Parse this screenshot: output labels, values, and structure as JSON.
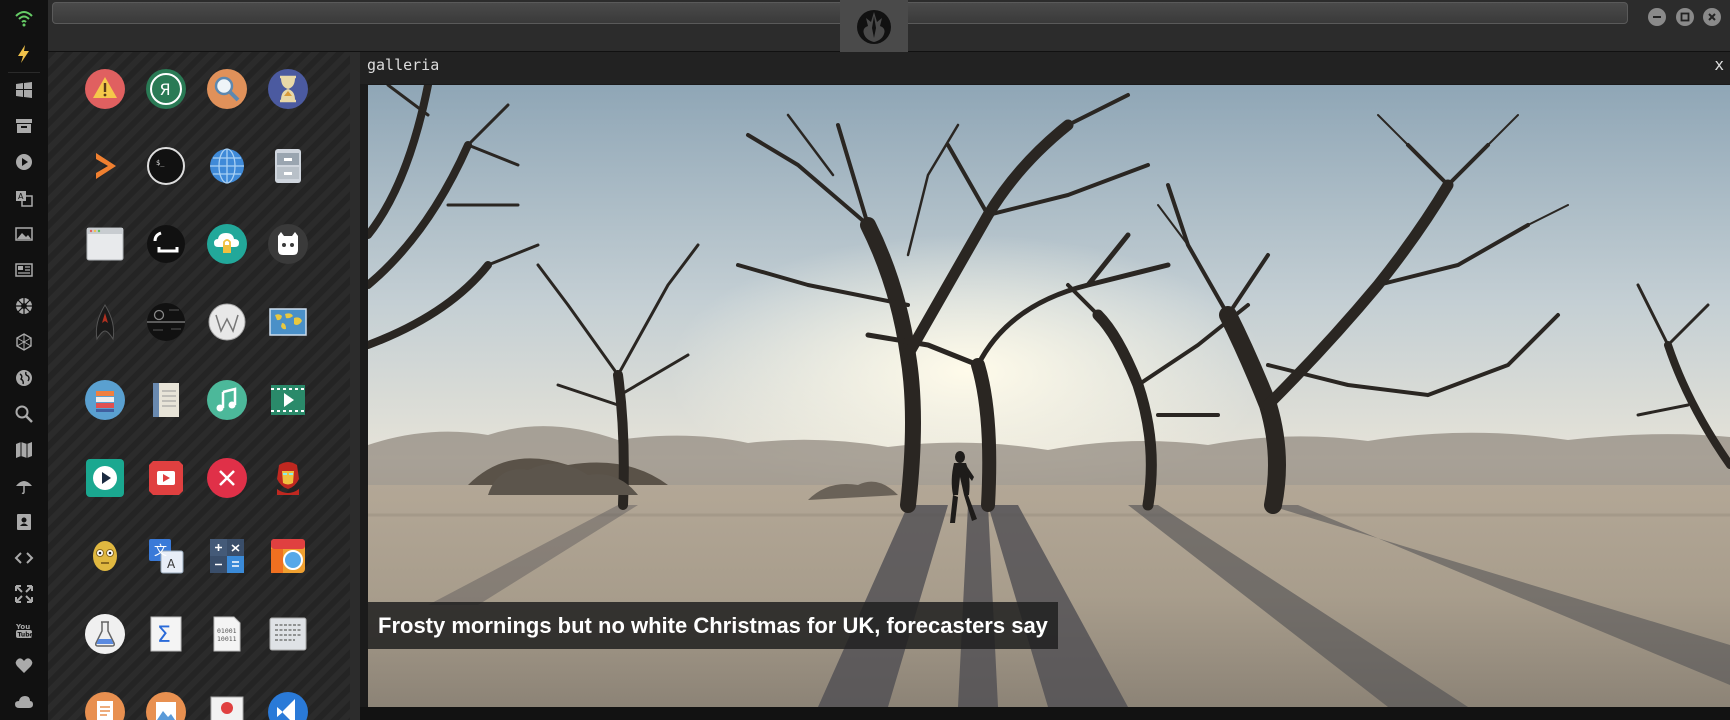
{
  "window": {
    "logo": "rebel-alliance-logo",
    "buttons": [
      "minimize",
      "maximize",
      "close"
    ]
  },
  "dock": {
    "items": [
      "wifi-icon",
      "lightning-icon",
      "windows-icon",
      "archive-icon",
      "play-icon",
      "translate-icon",
      "image-icon",
      "news-icon",
      "empire-icon",
      "network-icon",
      "globe-icon",
      "search-icon",
      "map-icon",
      "umbrella-icon",
      "contacts-icon",
      "code-icon",
      "expand-icon",
      "youtube-icon",
      "heart-icon",
      "cloud-icon"
    ]
  },
  "launcher": {
    "apps": [
      [
        "warning-app-icon",
        "yandex-app-icon",
        "search-app-icon",
        "hourglass-app-icon"
      ],
      [
        "sublime-app-icon",
        "terminal-app-icon",
        "browser-globe-app-icon",
        "file-cabinet-app-icon"
      ],
      [
        "window-app-icon",
        "bracket-app-icon",
        "cloud-lock-app-icon",
        "github-app-icon"
      ],
      [
        "starfleet-app-icon",
        "death-star-app-icon",
        "wikipedia-app-icon",
        "world-map-app-icon"
      ],
      [
        "books-app-icon",
        "notebook-app-icon",
        "music-app-icon",
        "video-app-icon"
      ],
      [
        "media-player-app-icon",
        "youtube-app-icon",
        "close-circle-app-icon",
        "iron-man-app-icon"
      ],
      [
        "c3po-app-icon",
        "translate-app-icon",
        "calculator-app-icon",
        "color-browser-app-icon"
      ],
      [
        "chemistry-app-icon",
        "sigma-app-icon",
        "binary-file-app-icon",
        "text-editor-app-icon"
      ],
      [
        "document-app-icon",
        "image-viewer-app-icon",
        "presentation-app-icon",
        "vscode-app-icon"
      ]
    ]
  },
  "gallery": {
    "title": "galleria",
    "close_label": "x",
    "caption": "Frosty mornings but no white Christmas for UK, forecasters say"
  }
}
